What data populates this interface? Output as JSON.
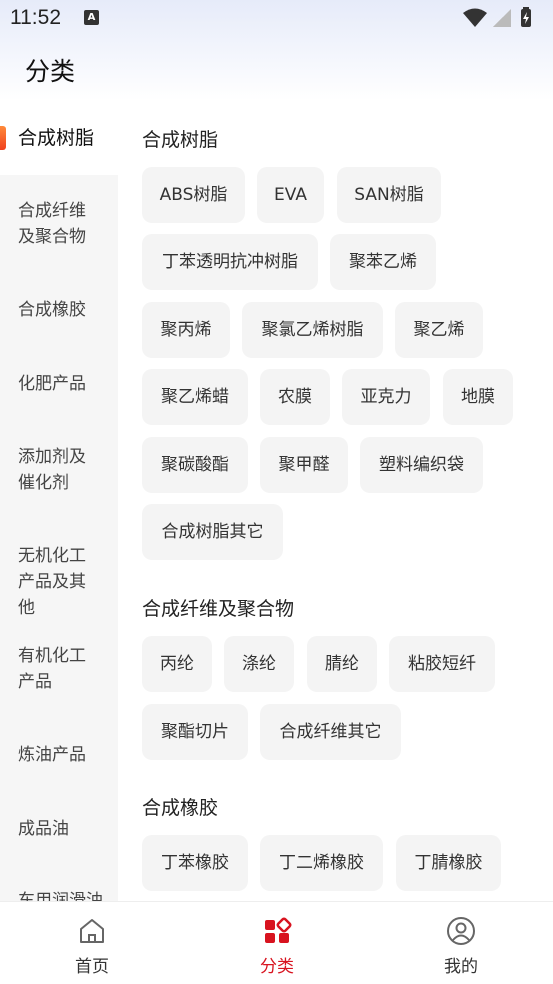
{
  "status": {
    "time": "11:52"
  },
  "header": {
    "title": "分类"
  },
  "sidebar": {
    "items": [
      {
        "label": "合成树脂"
      },
      {
        "label": "合成纤维及聚合物"
      },
      {
        "label": "合成橡胶"
      },
      {
        "label": "化肥产品"
      },
      {
        "label": "添加剂及催化剂"
      },
      {
        "label": "无机化工产品及其他"
      },
      {
        "label": "有机化工产品"
      },
      {
        "label": "炼油产品"
      },
      {
        "label": "成品油"
      },
      {
        "label": "车用润滑油"
      }
    ]
  },
  "sections": [
    {
      "title": "合成树脂",
      "items": [
        "ABS树脂",
        "EVA",
        "SAN树脂",
        "丁苯透明抗冲树脂",
        "聚苯乙烯",
        "聚丙烯",
        "聚氯乙烯树脂",
        "聚乙烯",
        "聚乙烯蜡",
        "农膜",
        "亚克力",
        "地膜",
        "聚碳酸酯",
        "聚甲醛",
        "塑料编织袋",
        "合成树脂其它"
      ]
    },
    {
      "title": "合成纤维及聚合物",
      "items": [
        "丙纶",
        "涤纶",
        "腈纶",
        "粘胶短纤",
        "聚酯切片",
        "合成纤维其它"
      ]
    },
    {
      "title": "合成橡胶",
      "items": [
        "丁苯橡胶",
        "丁二烯橡胶",
        "丁腈橡胶"
      ]
    }
  ],
  "tabbar": {
    "tabs": [
      {
        "label": "首页"
      },
      {
        "label": "分类"
      },
      {
        "label": "我的"
      }
    ]
  },
  "colors": {
    "accent": "#d8131f",
    "active_bar": "#f0401e",
    "chip_bg": "#f4f4f4",
    "sidebar_bg": "#f6f6f6"
  }
}
